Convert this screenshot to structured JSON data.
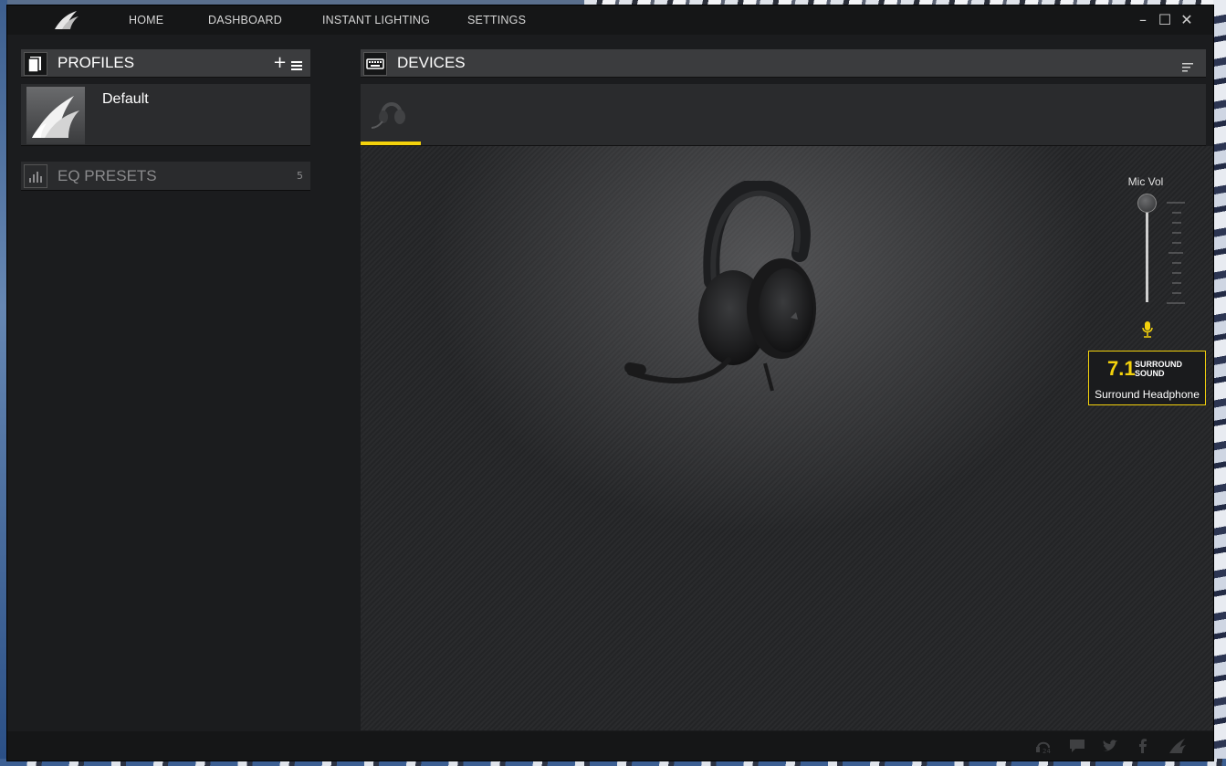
{
  "nav": {
    "items": [
      "HOME",
      "DASHBOARD",
      "INSTANT LIGHTING",
      "SETTINGS"
    ]
  },
  "window_controls": {
    "minimize": "–",
    "maximize": "☐",
    "close": "✕"
  },
  "profiles": {
    "title": "PROFILES",
    "add_label": "+",
    "items": [
      {
        "name": "Default"
      }
    ]
  },
  "eq_presets": {
    "title": "EQ PRESETS",
    "count": "5"
  },
  "devices": {
    "title": "DEVICES",
    "selected_device_icon": "headset-icon"
  },
  "controls": {
    "mic_vol_label": "Mic Vol",
    "mic_vol_level": 1.0,
    "surround_number": "7.1",
    "surround_line1": "SURROUND",
    "surround_line2": "SOUND",
    "surround_mode": "Surround Headphone"
  },
  "colors": {
    "accent": "#f4d20c",
    "panel_header": "#3b3c3e",
    "background": "#1b1c1e"
  },
  "footer_icons": [
    "help-24-icon",
    "chat-icon",
    "twitter-icon",
    "facebook-icon",
    "corsair-icon"
  ]
}
